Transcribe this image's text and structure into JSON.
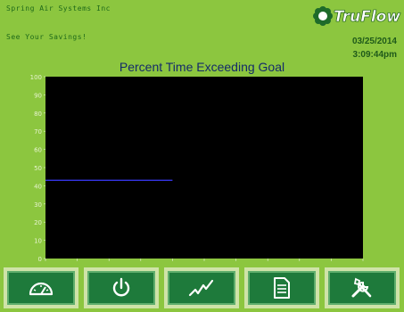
{
  "header": {
    "company": "Spring Air Systems Inc",
    "subtitle": "See Your Savings!",
    "logo_text": "TruFlow",
    "date": "03/25/2014",
    "time": "3:09:44pm"
  },
  "chart_data": {
    "type": "line",
    "title": "Percent Time Exceeding Goal",
    "xlabel": "",
    "ylabel": "",
    "ylim": [
      0,
      100
    ],
    "yticks": [
      0,
      10,
      20,
      30,
      40,
      50,
      60,
      70,
      80,
      90,
      100
    ],
    "xticks": [
      0,
      1,
      2,
      3,
      4,
      5,
      6,
      7,
      8,
      9,
      10
    ],
    "series": [
      {
        "color": "#3a3aff",
        "x": [
          0,
          4
        ],
        "y": [
          43,
          43
        ]
      }
    ],
    "background": "#000000",
    "grid": false
  },
  "toolbar": {
    "buttons": [
      {
        "name": "gauge-button",
        "icon": "gauge-icon"
      },
      {
        "name": "power-button",
        "icon": "power-icon"
      },
      {
        "name": "trend-button",
        "icon": "trend-icon"
      },
      {
        "name": "report-button",
        "icon": "document-icon"
      },
      {
        "name": "settings-button",
        "icon": "tools-icon"
      }
    ]
  },
  "colors": {
    "background": "#8cc63f",
    "button": "#1e7a3b",
    "title": "#142a6a"
  }
}
